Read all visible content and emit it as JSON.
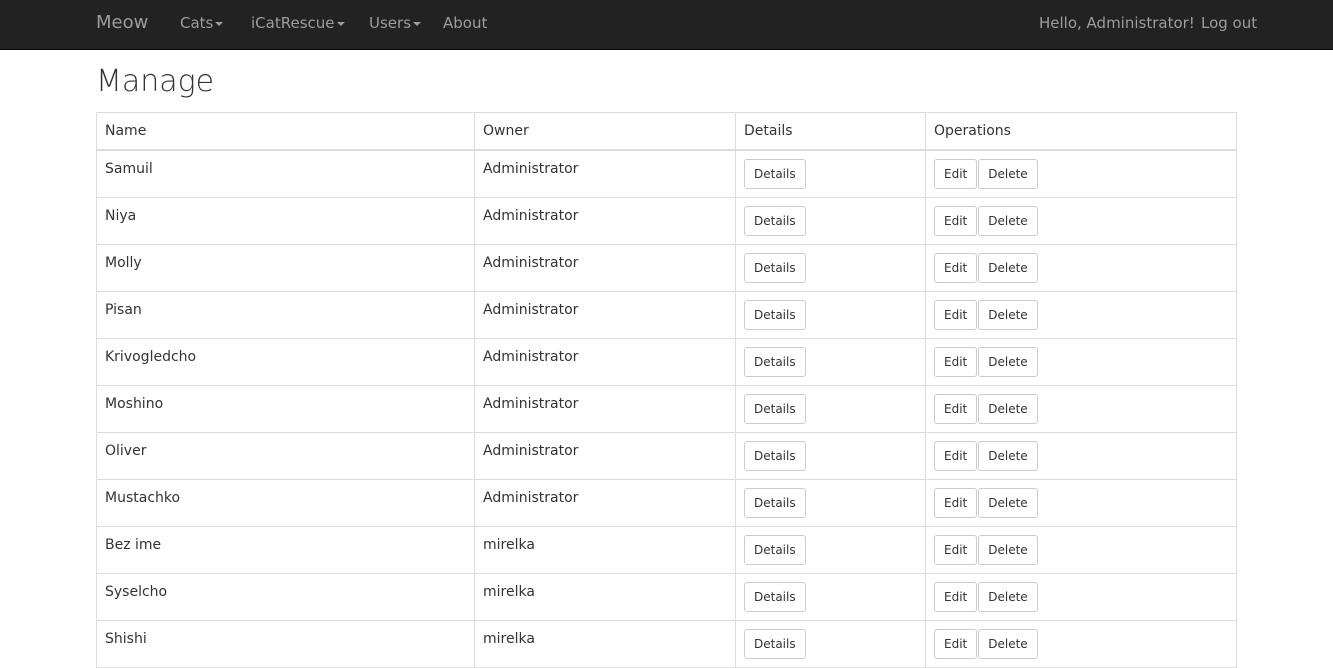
{
  "navbar": {
    "brand": "Meow",
    "menus": [
      "Cats",
      "iCatRescue",
      "Users"
    ],
    "about": "About",
    "greeting": "Hello, Administrator!",
    "logout": "Log out"
  },
  "page": {
    "title": "Manage"
  },
  "table": {
    "columns": [
      "Name",
      "Owner",
      "Details",
      "Operations"
    ],
    "rows": [
      {
        "name": "Samuil",
        "owner": "Administrator"
      },
      {
        "name": "Niya",
        "owner": "Administrator"
      },
      {
        "name": "Molly",
        "owner": "Administrator"
      },
      {
        "name": "Pisan",
        "owner": "Administrator"
      },
      {
        "name": "Krivogledcho",
        "owner": "Administrator"
      },
      {
        "name": "Moshino",
        "owner": "Administrator"
      },
      {
        "name": "Oliver",
        "owner": "Administrator"
      },
      {
        "name": "Mustachko",
        "owner": "Administrator"
      },
      {
        "name": "Bez ime",
        "owner": "mirelka"
      },
      {
        "name": "Syselcho",
        "owner": "mirelka"
      },
      {
        "name": "Shishi",
        "owner": "mirelka"
      }
    ],
    "details_label": "Details",
    "edit_label": "Edit",
    "delete_label": "Delete"
  }
}
